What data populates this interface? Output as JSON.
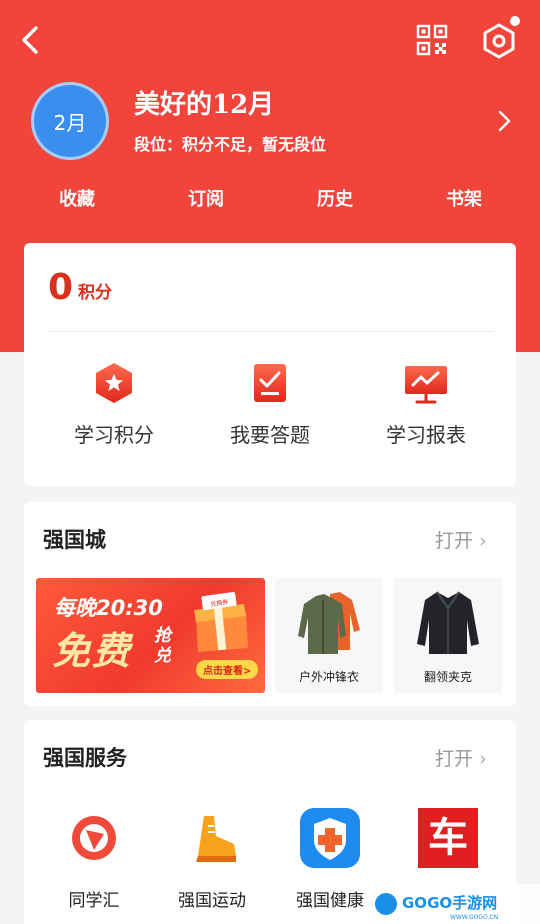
{
  "colors": {
    "brand_red": "#f1453b",
    "points_red": "#d8321f",
    "avatar_blue": "#3a8fee"
  },
  "header": {
    "icons": [
      "back-arrow-icon",
      "qr-code-icon",
      "settings-hexagon-icon"
    ],
    "avatar_text": "2月",
    "username": "美好的12月",
    "rank": "段位：积分不足，暂无段位"
  },
  "quicknav": [
    "收藏",
    "订阅",
    "历史",
    "书架"
  ],
  "points": {
    "value": "0",
    "unit": "积分",
    "features": [
      {
        "label": "学习积分",
        "icon": "badge-star-icon"
      },
      {
        "label": "我要答题",
        "icon": "check-document-icon"
      },
      {
        "label": "学习报表",
        "icon": "report-chart-icon"
      }
    ]
  },
  "mall": {
    "title": "强国城",
    "open_label": "打开",
    "promo": {
      "line1": "每晚20:30",
      "big": "免费",
      "side": "抢兑",
      "cta": "点击查看>",
      "gift": "兑换券"
    },
    "products": [
      {
        "name": "户外冲锋衣",
        "icon": "outdoor-jacket-icon"
      },
      {
        "name": "翻领夹克",
        "icon": "lapel-jacket-icon"
      }
    ]
  },
  "services": {
    "title": "强国服务",
    "open_label": "打开",
    "items": [
      {
        "label": "同学汇",
        "icon": "classmates-logo-icon"
      },
      {
        "label": "强国运动",
        "icon": "sneaker-icon"
      },
      {
        "label": "强国健康",
        "icon": "health-shield-icon"
      },
      {
        "label": "车",
        "icon": "car-logo-icon"
      }
    ]
  },
  "watermark": {
    "brand": "GOGO手游网",
    "url": "WWW.GOGO.CN"
  }
}
